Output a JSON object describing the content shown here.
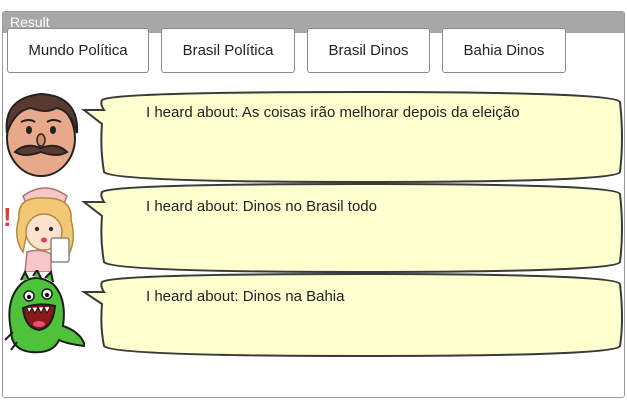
{
  "window": {
    "title": "Result"
  },
  "buttons": [
    {
      "label": "Mundo Política"
    },
    {
      "label": "Brasil Política"
    },
    {
      "label": "Brasil Dinos"
    },
    {
      "label": "Bahia Dinos"
    }
  ],
  "messages": [
    {
      "avatar": "mustache-man-icon",
      "text": "I heard about: As coisas irão melhorar depois da eleição"
    },
    {
      "avatar": "nurse-girl-icon",
      "text": "I heard about: Dinos no Brasil todo"
    },
    {
      "avatar": "green-dinosaur-icon",
      "text": "I heard about: Dinos na Bahia"
    }
  ],
  "colors": {
    "titlebar": "#a7a7a7",
    "bubble_fill": "#fdffcf",
    "bubble_stroke": "#3a3a3a"
  }
}
